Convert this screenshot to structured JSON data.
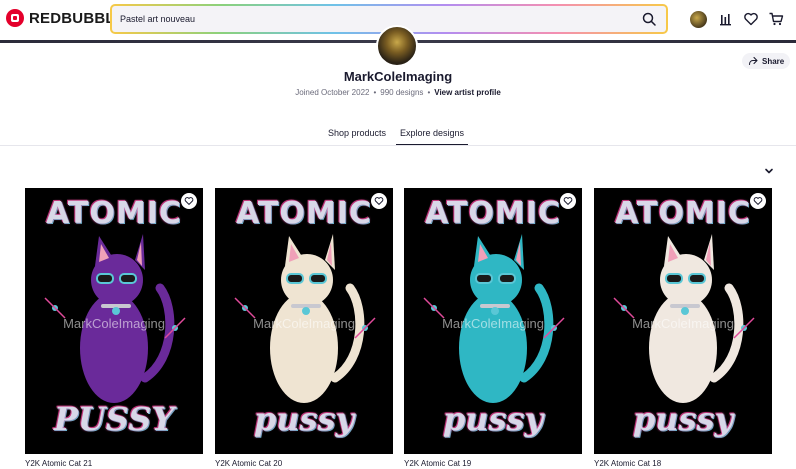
{
  "header": {
    "logo_text": "REDBUBBLE",
    "search_value": "Pastel art nouveau",
    "icons": [
      "search-icon",
      "avatar",
      "dashboard-icon",
      "heart-icon",
      "cart-icon"
    ]
  },
  "profile": {
    "name": "MarkColeImaging",
    "joined": "Joined October 2022",
    "designs": "990 designs",
    "view_profile": "View artist profile",
    "share_label": "Share"
  },
  "tabs": [
    {
      "label": "Shop products",
      "active": false
    },
    {
      "label": "Explore designs",
      "active": true
    }
  ],
  "designs": [
    {
      "title": "Y2K Atomic Cat 21",
      "art_top": "ATOMIC",
      "art_bottom": "PUSSY",
      "watermark": "MarkColeImaging",
      "cat_color": "#6a2a9a"
    },
    {
      "title": "Y2K Atomic Cat 20",
      "art_top": "ATOMIC",
      "art_bottom": "pussy",
      "watermark": "MarkColeImaging",
      "cat_color": "#efe4d2"
    },
    {
      "title": "Y2K Atomic Cat 19",
      "art_top": "ATOMIC",
      "art_bottom": "pussy",
      "watermark": "MarkColeImaging",
      "cat_color": "#2fb7c4"
    },
    {
      "title": "Y2K Atomic Cat 18",
      "art_top": "ATOMIC",
      "art_bottom": "pussy",
      "watermark": "MarkColeImaging",
      "cat_color": "#f0e8e0"
    }
  ],
  "colors": {
    "brand_red": "#e4002b",
    "accent_pink": "#e04a9a",
    "accent_teal": "#5ac7d6"
  }
}
